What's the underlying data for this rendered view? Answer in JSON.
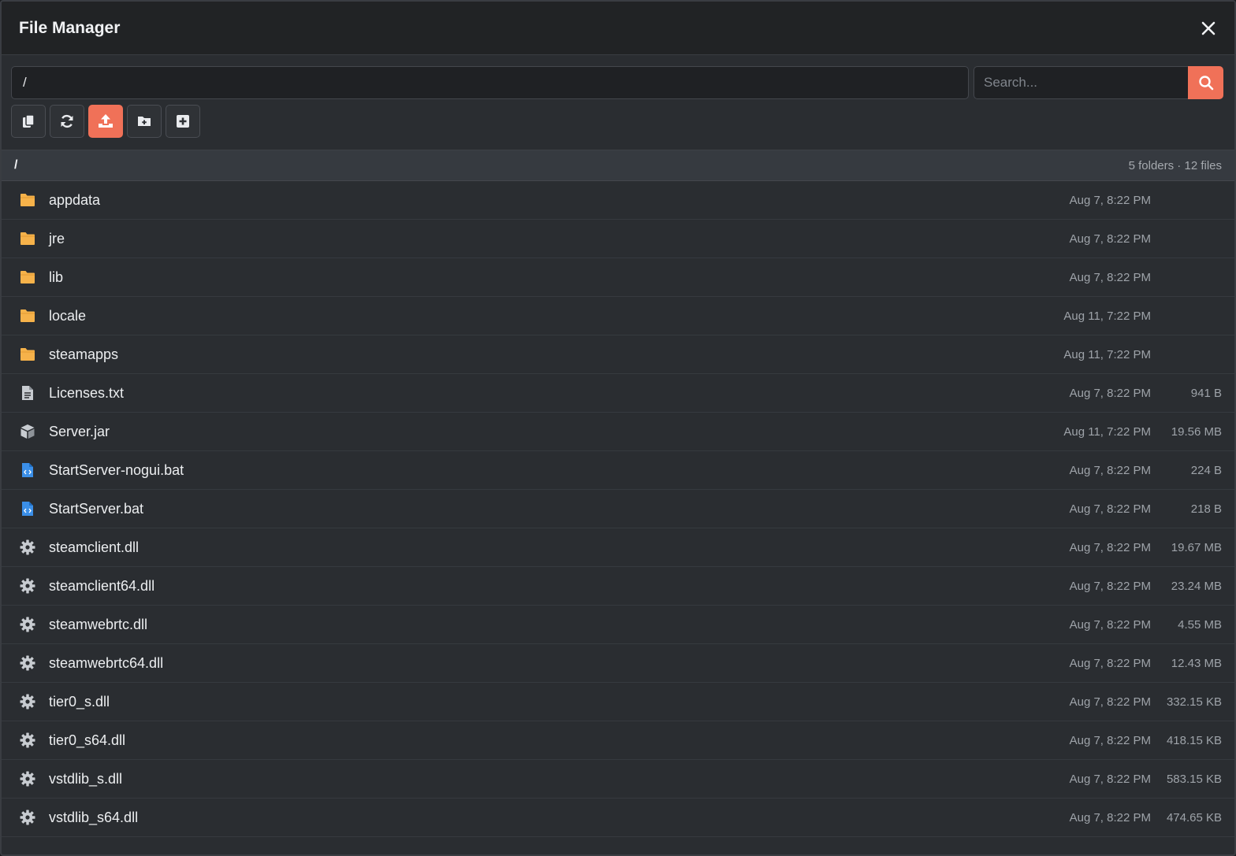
{
  "header": {
    "title": "File Manager"
  },
  "path_input": {
    "value": "/"
  },
  "search": {
    "placeholder": "Search..."
  },
  "toolbar": {
    "buttons": [
      {
        "icon": "copy-icon"
      },
      {
        "icon": "refresh-icon"
      },
      {
        "icon": "upload-icon",
        "active": true
      },
      {
        "icon": "new-folder-icon"
      },
      {
        "icon": "new-file-icon"
      }
    ]
  },
  "list": {
    "path": "/",
    "summary": "5 folders · 12 files",
    "items": [
      {
        "name": "appdata",
        "type": "folder",
        "date": "Aug 7, 8:22 PM",
        "size": ""
      },
      {
        "name": "jre",
        "type": "folder",
        "date": "Aug 7, 8:22 PM",
        "size": ""
      },
      {
        "name": "lib",
        "type": "folder",
        "date": "Aug 7, 8:22 PM",
        "size": ""
      },
      {
        "name": "locale",
        "type": "folder",
        "date": "Aug 11, 7:22 PM",
        "size": ""
      },
      {
        "name": "steamapps",
        "type": "folder",
        "date": "Aug 11, 7:22 PM",
        "size": ""
      },
      {
        "name": "Licenses.txt",
        "type": "text",
        "date": "Aug 7, 8:22 PM",
        "size": "941 B"
      },
      {
        "name": "Server.jar",
        "type": "archive",
        "date": "Aug 11, 7:22 PM",
        "size": "19.56 MB"
      },
      {
        "name": "StartServer-nogui.bat",
        "type": "script",
        "date": "Aug 7, 8:22 PM",
        "size": "224 B"
      },
      {
        "name": "StartServer.bat",
        "type": "script",
        "date": "Aug 7, 8:22 PM",
        "size": "218 B"
      },
      {
        "name": "steamclient.dll",
        "type": "binary",
        "date": "Aug 7, 8:22 PM",
        "size": "19.67 MB"
      },
      {
        "name": "steamclient64.dll",
        "type": "binary",
        "date": "Aug 7, 8:22 PM",
        "size": "23.24 MB"
      },
      {
        "name": "steamwebrtc.dll",
        "type": "binary",
        "date": "Aug 7, 8:22 PM",
        "size": "4.55 MB"
      },
      {
        "name": "steamwebrtc64.dll",
        "type": "binary",
        "date": "Aug 7, 8:22 PM",
        "size": "12.43 MB"
      },
      {
        "name": "tier0_s.dll",
        "type": "binary",
        "date": "Aug 7, 8:22 PM",
        "size": "332.15 KB"
      },
      {
        "name": "tier0_s64.dll",
        "type": "binary",
        "date": "Aug 7, 8:22 PM",
        "size": "418.15 KB"
      },
      {
        "name": "vstdlib_s.dll",
        "type": "binary",
        "date": "Aug 7, 8:22 PM",
        "size": "583.15 KB"
      },
      {
        "name": "vstdlib_s64.dll",
        "type": "binary",
        "date": "Aug 7, 8:22 PM",
        "size": "474.65 KB"
      }
    ]
  },
  "colors": {
    "accent": "#f07158",
    "folder": "#f6b24a",
    "script": "#3b8fe8",
    "file": "#c8ccd1"
  }
}
